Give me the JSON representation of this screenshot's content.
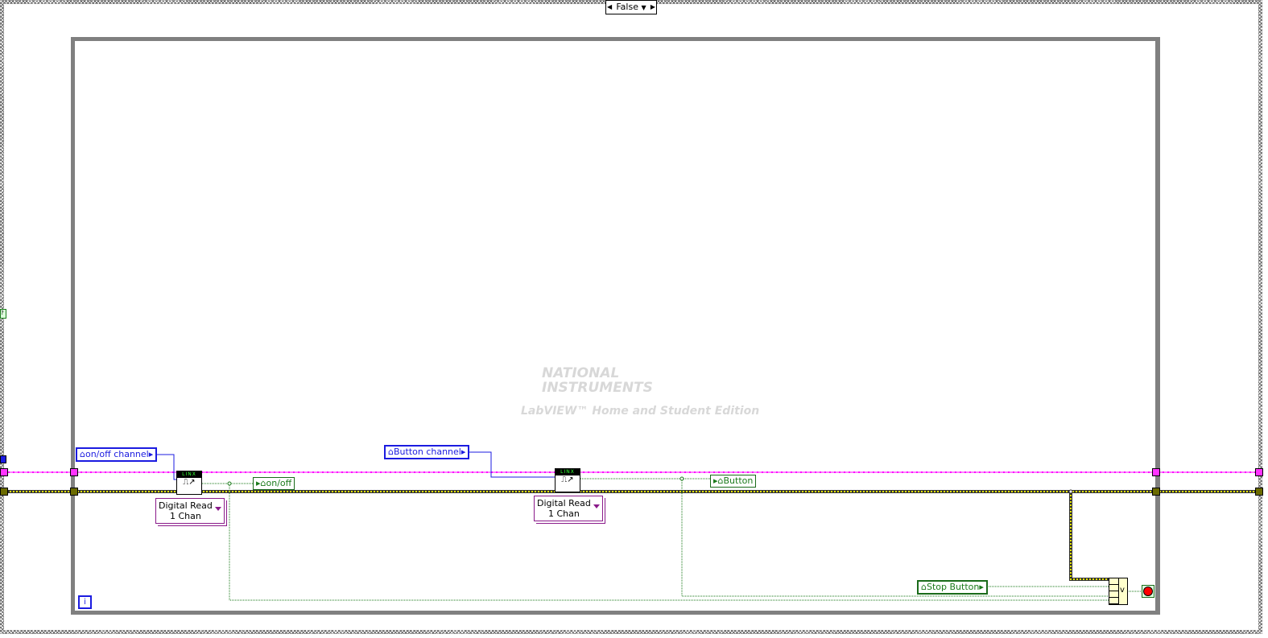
{
  "case_selector": {
    "value": "False"
  },
  "controls": {
    "onoff_channel": "on/off channel",
    "button_channel": "Button channel",
    "stop_button": "Stop Button"
  },
  "indicators": {
    "onoff": "on/off",
    "button": "Button"
  },
  "subvis": [
    {
      "header": "LINX",
      "polymorphic": "Digital Read\n1 Chan",
      "line1": "Digital Read",
      "line2": "1 Chan"
    },
    {
      "header": "LINX",
      "line1": "Digital Read",
      "line2": "1 Chan"
    }
  ],
  "or_function": "v",
  "loop_iteration": "i",
  "watermark": {
    "brand": "NATIONAL INSTRUMENTS",
    "edition": "LabVIEW™ Home and Student Edition"
  },
  "colors": {
    "pink_wire": "#ff00ff",
    "error_wire": "#d4d400",
    "boolean_wire": "#1a7a1a",
    "numeric_wire": "#1b1be0",
    "loop_border": "#808080"
  }
}
